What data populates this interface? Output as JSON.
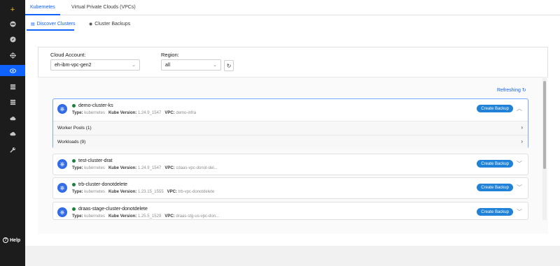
{
  "top_tabs": {
    "kubernetes": "Kubernetes",
    "vpcs": "Virtual Private Clouds (VPCs)"
  },
  "sub_tabs": {
    "discover": "Discover Clusters",
    "backups": "Cluster Backups"
  },
  "filters": {
    "cloud_account_label": "Cloud Account:",
    "cloud_account_value": "eh-ibm-vpc-gen2",
    "region_label": "Region:",
    "region_value": "all"
  },
  "refreshing_label": "Refreshing",
  "create_backup_label": "Create Backup",
  "meta_labels": {
    "type": "Type:",
    "kube": "Kube Version:",
    "vpc": "VPC:"
  },
  "clusters": [
    {
      "name": "demo-cluster-ks",
      "type": "kubernetes",
      "kube_version": "1.24.9_1547",
      "vpc": "demo-infra",
      "expanded": true,
      "rows": [
        "Worker Pools (1)",
        "Workloads (9)"
      ]
    },
    {
      "name": "test-cluster-drat",
      "type": "kubernetes",
      "kube_version": "1.24.9_1547",
      "vpc": "cdaas-vpc-donot-del..."
    },
    {
      "name": "trb-cluster-donotdelete",
      "type": "kubernetes",
      "kube_version": "1.23.15_1555",
      "vpc": "trb-vpc-donotdelete"
    },
    {
      "name": "draas-stage-cluster-donotdelete",
      "type": "kubernetes",
      "kube_version": "1.25.5_1529",
      "vpc": "draas-stg-us-vpc-don..."
    }
  ],
  "help_label": "Help",
  "colors": {
    "accent": "#0f62fe",
    "button": "#1f82d8",
    "status_ok": "#198038",
    "sidebar": "#1c1c1c"
  },
  "sidebar_icons": [
    "plus-icon",
    "dashboard-icon",
    "compass-icon",
    "crosshair-icon",
    "eye-icon",
    "list-icon",
    "list-icon",
    "cloud-icon",
    "cloud-icon",
    "wrench-icon"
  ]
}
